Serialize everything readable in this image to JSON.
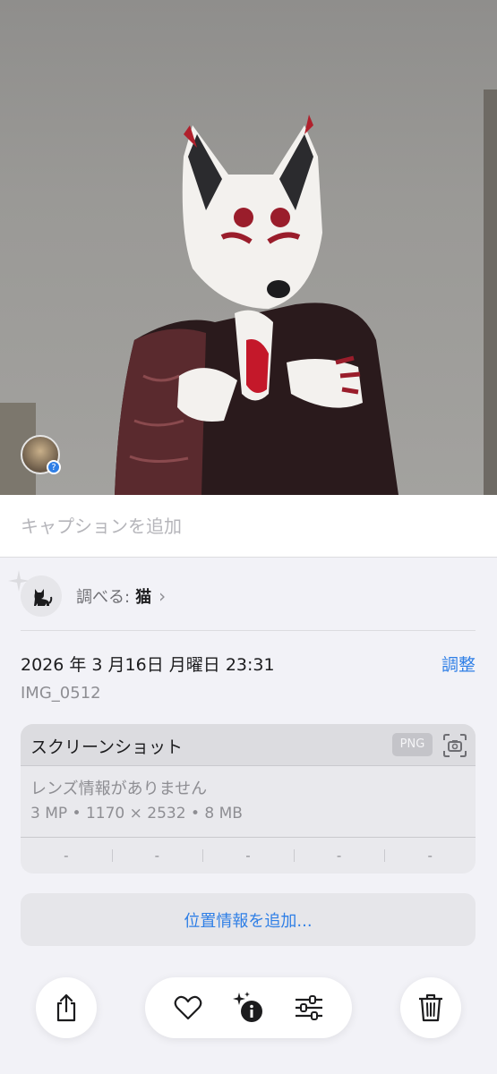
{
  "photo": {
    "subject_description_icon": "fox-mask-figure"
  },
  "caption": {
    "placeholder": "キャプションを追加",
    "value": ""
  },
  "lookup": {
    "prefix": "調べる:",
    "subject": "猫",
    "icon": "cat-icon"
  },
  "info": {
    "date": "2026 年 3 月16日 月曜日 23:31",
    "adjust_label": "調整",
    "file_name": "IMG_0512"
  },
  "metadata": {
    "title": "スクリーンショット",
    "format_badge": "PNG",
    "lens_info": "レンズ情報がありません",
    "specs": "3 MP • 1170 × 2532 • 8 MB",
    "exif": [
      "-",
      "-",
      "-",
      "-",
      "-"
    ]
  },
  "location": {
    "add_label": "位置情報を追加..."
  },
  "toolbar": {
    "share": "share-icon",
    "favorite": "heart-icon",
    "info": "info-sparkle-icon",
    "edit": "sliders-icon",
    "delete": "trash-icon"
  },
  "colors": {
    "accent": "#2f7fe6",
    "background": "#f2f2f7"
  }
}
